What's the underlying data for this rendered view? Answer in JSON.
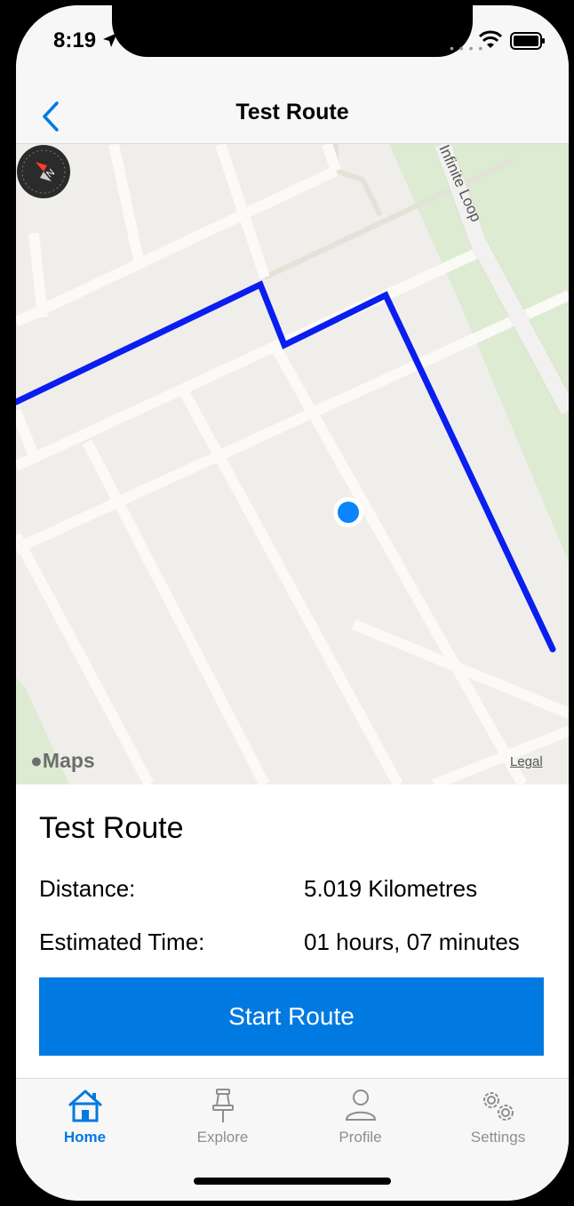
{
  "status_bar": {
    "time": "8:19",
    "icons": [
      "location-arrow-icon",
      "signal-icon",
      "wifi-icon",
      "battery-icon"
    ]
  },
  "nav": {
    "title": "Test Route",
    "back_icon": "chevron-left-icon"
  },
  "map": {
    "street_label": "Infinite Loop",
    "attribution": "Maps",
    "legal": "Legal",
    "route_color": "#0a1ef0",
    "user_location_color": "#0a84ff",
    "compass_icon": "compass-icon"
  },
  "details": {
    "route_name": "Test Route",
    "distance_label": "Distance:",
    "distance_value": "5.019 Kilometres",
    "time_label": "Estimated Time:",
    "time_value": "01 hours, 07 minutes",
    "start_button": "Start Route"
  },
  "tabs": [
    {
      "label": "Home",
      "icon": "home-icon",
      "active": true
    },
    {
      "label": "Explore",
      "icon": "pin-icon",
      "active": false
    },
    {
      "label": "Profile",
      "icon": "person-icon",
      "active": false
    },
    {
      "label": "Settings",
      "icon": "gears-icon",
      "active": false
    }
  ],
  "colors": {
    "accent": "#007ae0",
    "inactive_tab": "#8e8e8e",
    "map_background": "#efeeea",
    "park_green": "#dcebd2"
  }
}
